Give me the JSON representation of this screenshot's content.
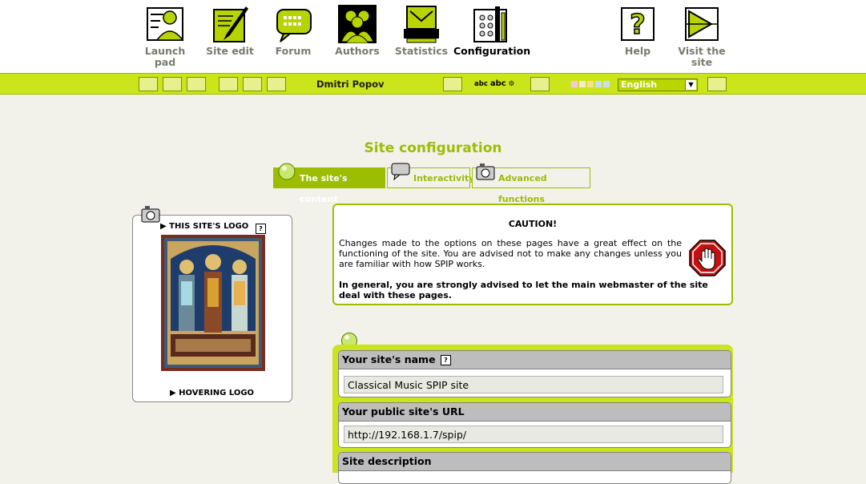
{
  "nav": {
    "items": [
      {
        "label": "Launch pad",
        "icon": "launch-pad-icon"
      },
      {
        "label": "Site edit",
        "icon": "site-edit-icon"
      },
      {
        "label": "Forum",
        "icon": "forum-icon"
      },
      {
        "label": "Authors",
        "icon": "authors-icon"
      },
      {
        "label": "Statistics",
        "icon": "statistics-icon"
      },
      {
        "label": "Configuration",
        "icon": "configuration-icon",
        "active": true
      },
      {
        "label": "Help",
        "icon": "help-icon"
      },
      {
        "label": "Visit the site",
        "icon": "visit-site-icon"
      }
    ]
  },
  "toolbar": {
    "user_name": "Dmitri Popov",
    "language": "English",
    "text_size_sample": "abc"
  },
  "page": {
    "title": "Site configuration",
    "tabs": [
      {
        "label": "The site's content",
        "active": true
      },
      {
        "label": "Interactivity",
        "active": false
      },
      {
        "label": "Advanced functions",
        "active": false
      }
    ]
  },
  "logo_panel": {
    "site_logo_heading": "THIS SITE'S LOGO",
    "hovering_logo_heading": "HOVERING LOGO"
  },
  "caution": {
    "title": "CAUTION!",
    "text": "Changes made to the options on these pages have a great effect on the functioning of the site. You are advised not to make any changes unless you are familiar with how SPIP works.",
    "strong": "In general, you are strongly advised to let the main webmaster of the site deal with these pages."
  },
  "form": {
    "site_name_label": "Your site's name",
    "site_name_value": "Classical Music SPIP site",
    "site_url_label": "Your public site's URL",
    "site_url_value": "http://192.168.1.7/spip/",
    "site_description_label": "Site description"
  },
  "colors": {
    "accent": "#9cbd00",
    "toolbar": "#cbe51c",
    "background": "#f3f2ea"
  }
}
